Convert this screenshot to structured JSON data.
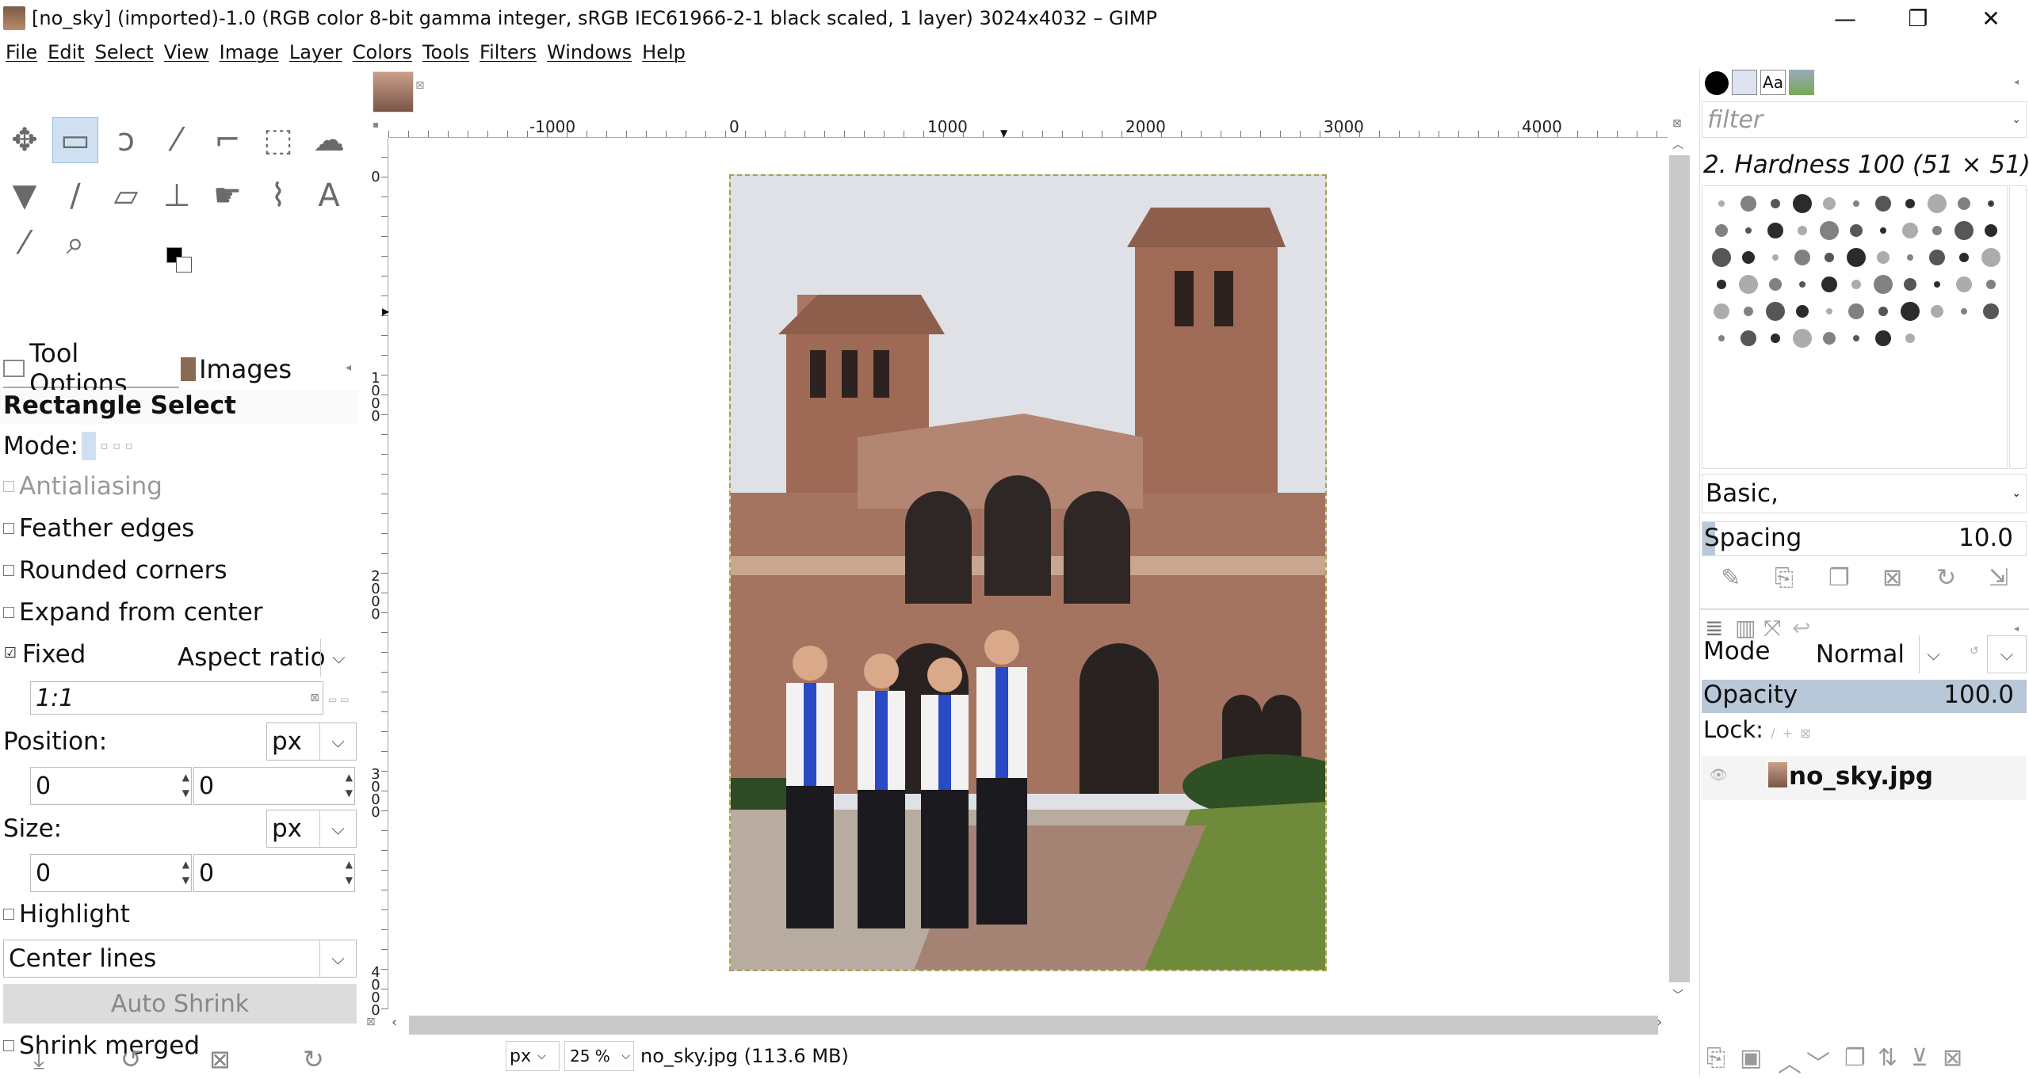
{
  "window": {
    "title": "[no_sky] (imported)-1.0 (RGB color 8-bit gamma integer, sRGB IEC61966-2-1 black scaled, 1 layer) 3024x4032 – GIMP",
    "minimize": "—",
    "restore": "❐",
    "close": "✕"
  },
  "menu": [
    "File",
    "Edit",
    "Select",
    "View",
    "Image",
    "Layer",
    "Colors",
    "Tools",
    "Filters",
    "Windows",
    "Help"
  ],
  "toolbox": {
    "tools": [
      {
        "name": "move-tool-icon",
        "glyph": "✥",
        "selected": false
      },
      {
        "name": "rect-select-tool-icon",
        "glyph": "▭",
        "selected": true
      },
      {
        "name": "free-select-tool-icon",
        "glyph": "ↄ",
        "selected": false
      },
      {
        "name": "fuzzy-select-tool-icon",
        "glyph": "⁄",
        "selected": false
      },
      {
        "name": "crop-tool-icon",
        "glyph": "⌐",
        "selected": false
      },
      {
        "name": "unified-transform-tool-icon",
        "glyph": "⬚",
        "selected": false
      },
      {
        "name": "warp-transform-tool-icon",
        "glyph": "☁",
        "selected": false
      },
      {
        "name": "bucket-fill-tool-icon",
        "glyph": "▼",
        "selected": false
      },
      {
        "name": "paintbrush-tool-icon",
        "glyph": "∕",
        "selected": false
      },
      {
        "name": "eraser-tool-icon",
        "glyph": "▱",
        "selected": false
      },
      {
        "name": "clone-tool-icon",
        "glyph": "⊥",
        "selected": false
      },
      {
        "name": "smudge-tool-icon",
        "glyph": "☛",
        "selected": false
      },
      {
        "name": "paths-tool-icon",
        "glyph": "⌇",
        "selected": false
      },
      {
        "name": "text-tool-icon",
        "glyph": "A",
        "selected": false
      },
      {
        "name": "color-picker-tool-icon",
        "glyph": "⁄",
        "selected": false
      },
      {
        "name": "zoom-tool-icon",
        "glyph": "⌕",
        "selected": false
      }
    ]
  },
  "tooloptions": {
    "tab_tool_options": "Tool Options",
    "tab_images": "Images",
    "heading": "Rectangle Select",
    "mode_label": "Mode:",
    "antialiasing": "Antialiasing",
    "feather_edges": "Feather edges",
    "rounded_corners": "Rounded corners",
    "expand_from_center": "Expand from center",
    "fixed": "Fixed",
    "fixed_checked": "☑",
    "aspect_ratio": "Aspect ratio",
    "ratio_value": "1:1",
    "position_label": "Position:",
    "position_unit": "px",
    "position_x": "0",
    "position_y": "0",
    "size_label": "Size:",
    "size_unit": "px",
    "size_w": "0",
    "size_h": "0",
    "highlight": "Highlight",
    "guides": "Center lines",
    "auto_shrink": "Auto Shrink",
    "shrink_merged": "Shrink merged"
  },
  "ruler": {
    "h_labels": [
      "-1000",
      "0",
      "1000",
      "2000",
      "3000",
      "4000"
    ],
    "v_labels": [
      "0",
      "1000",
      "2000",
      "3000",
      "4000"
    ]
  },
  "status": {
    "unit": "px",
    "zoom": "25 %",
    "file_info": "no_sky.jpg (113.6 MB)"
  },
  "brushes": {
    "filter_placeholder": "filter",
    "current_brush": "2. Hardness 100 (51 × 51)",
    "preset": "Basic,",
    "spacing_label": "Spacing",
    "spacing_value": "10.0"
  },
  "layers": {
    "mode_label": "Mode",
    "mode_value": "Normal",
    "opacity_label": "Opacity",
    "opacity_value": "100.0",
    "lock_label": "Lock:",
    "layer_name": "no_sky.jpg"
  },
  "colors": {
    "selection_bg": "#cfe0f3",
    "opacity_bar": "#b9c8d8",
    "scroll_thumb": "#c9c9c9"
  }
}
